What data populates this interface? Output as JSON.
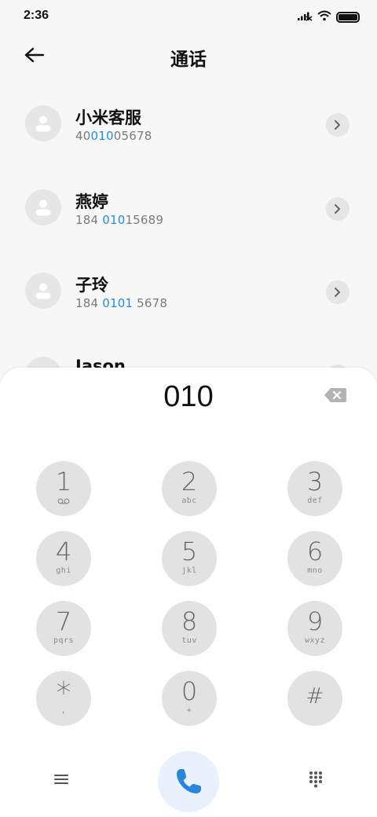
{
  "status_bar": {
    "time": "2:36",
    "icons": [
      "signal-icon",
      "wifi-icon",
      "battery-icon"
    ]
  },
  "header": {
    "title": "通话",
    "back_icon": "arrow-left-icon"
  },
  "contacts": [
    {
      "name": "小米客服",
      "number_pre": "40",
      "number_hl": "010",
      "number_post": "05678"
    },
    {
      "name": "燕婷",
      "number_pre": "184 ",
      "number_hl": "010",
      "number_post": "15689"
    },
    {
      "name": "子玲",
      "number_pre": "184 ",
      "number_hl": "0101",
      "number_post": " 5678"
    },
    {
      "name": "Jason",
      "number_pre": "",
      "number_hl": "",
      "number_post": ""
    }
  ],
  "dialer": {
    "display": "010",
    "backspace_icon": "backspace-icon",
    "keys": [
      {
        "digit": "1",
        "letters": ""
      },
      {
        "digit": "2",
        "letters": "abc"
      },
      {
        "digit": "3",
        "letters": "def"
      },
      {
        "digit": "4",
        "letters": "ghi"
      },
      {
        "digit": "5",
        "letters": "jkl"
      },
      {
        "digit": "6",
        "letters": "mno"
      },
      {
        "digit": "7",
        "letters": "pqrs"
      },
      {
        "digit": "8",
        "letters": "tuv"
      },
      {
        "digit": "9",
        "letters": "wxyz"
      },
      {
        "digit": "*",
        "letters": ","
      },
      {
        "digit": "0",
        "letters": "+"
      },
      {
        "digit": "#",
        "letters": ""
      }
    ],
    "voicemail_icon": "voicemail-icon"
  },
  "bottom_bar": {
    "menu_icon": "menu-icon",
    "call_icon": "phone-icon",
    "keypad_icon": "dialpad-icon"
  },
  "colors": {
    "highlight": "#1f8fe0",
    "call_button_bg": "#e9f2fc",
    "call_icon": "#2a86dc",
    "key_bg": "#e2e2e2",
    "page_bg": "#f7f7f7"
  }
}
